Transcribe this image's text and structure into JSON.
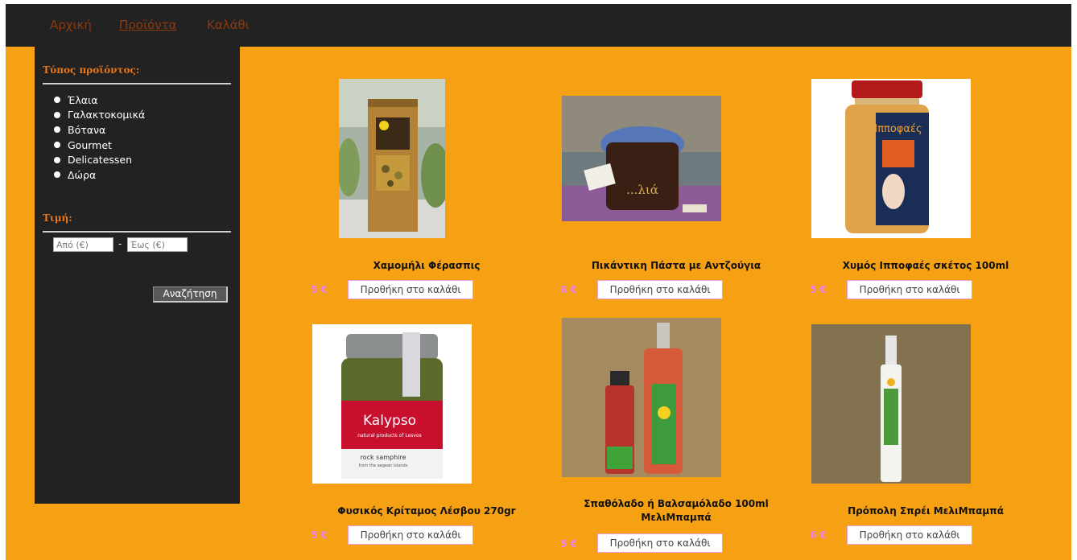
{
  "nav": {
    "items": [
      {
        "label": "Αρχική",
        "active": false
      },
      {
        "label": "Προϊόντα",
        "active": true
      },
      {
        "label": "Καλάθι",
        "active": false
      }
    ]
  },
  "sidebar": {
    "type_title": "Τύπος προϊόντος:",
    "categories": [
      "Έλαια",
      "Γαλακτοκομικά",
      "Βότανα",
      "Gourmet",
      "Delicatessen",
      "Δώρα"
    ],
    "price_title": "Τιμή:",
    "from_placeholder": "Από (€)",
    "to_placeholder": "Έως (€)",
    "separator": "-",
    "search_label": "Αναζήτηση"
  },
  "products": [
    {
      "name": "Χαμομήλι Φέρασπις",
      "price": "5 €",
      "button": "Προθήκη στο καλάθι"
    },
    {
      "name": "Πικάντικη Πάστα με Αντζούγια",
      "price": "6 €",
      "button": "Προθήκη στο καλάθι"
    },
    {
      "name": "Χυμός Ιπποφαές σκέτος 100ml",
      "price": "5 €",
      "button": "Προθήκη στο καλάθι"
    },
    {
      "name": "Φυσικός Κρίταμος Λέσβου 270gr",
      "price": "5 €",
      "button": "Προθήκη στο καλάθι"
    },
    {
      "name": "Σπαθόλαδο ή Βαλσαμόλαδο 100ml ΜελιΜπαμπά",
      "price": "5 €",
      "button": "Προθήκη στο καλάθι"
    },
    {
      "name": "Πρόπολη Σπρέι ΜελιΜπαμπά",
      "price": "6 €",
      "button": "Προθήκη στο καλάθι"
    }
  ],
  "image_text": {
    "paste_label": "...λιά",
    "jar_brand": "Ιπποφαές",
    "kalypso_brand": "Kalypso",
    "kalypso_sub": "natural products of Lesvos",
    "kalypso_product": "rock samphire",
    "kalypso_desc": "from the aegean islands"
  },
  "colors": {
    "page_bg": "#f5a113",
    "nav_bg": "#222222",
    "nav_link": "#8c3a0e",
    "sidebar_bg": "#222222",
    "sidebar_title": "#e8761a",
    "price_color": "#ee82ee",
    "button_border": "#e8a0d0"
  }
}
